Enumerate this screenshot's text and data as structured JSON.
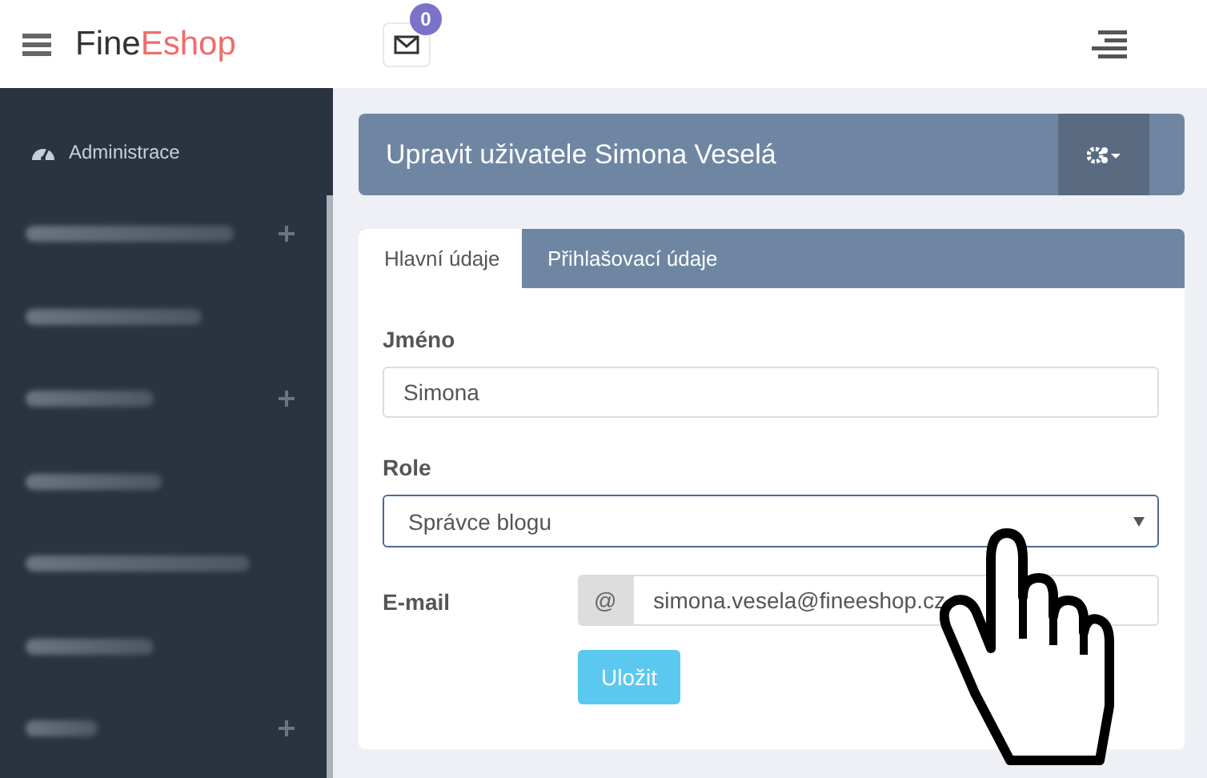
{
  "topbar": {
    "brand_first": "Fine",
    "brand_second": "Eshop",
    "messages_badge": "0"
  },
  "sidebar": {
    "items": [
      {
        "kind": "link",
        "label": "Administrace"
      },
      {
        "kind": "blurred",
        "expandable": true
      },
      {
        "kind": "blurred",
        "expandable": false
      },
      {
        "kind": "blurred",
        "expandable": true
      },
      {
        "kind": "blurred",
        "expandable": false
      },
      {
        "kind": "blurred",
        "expandable": false
      },
      {
        "kind": "blurred",
        "expandable": false
      },
      {
        "kind": "blurred",
        "expandable": true
      }
    ]
  },
  "header": {
    "title": "Upravit uživatele Simona Veselá"
  },
  "tabs": [
    {
      "label": "Hlavní údaje",
      "selected": true
    },
    {
      "label": "Přihlašovací údaje",
      "selected": false
    }
  ],
  "form": {
    "name_label": "Jméno",
    "name_value": "Simona",
    "role_label": "Role",
    "role_value": "Správce blogu",
    "email_label": "E-mail",
    "email_addon": "@",
    "email_value": "simona.vesela@fineeshop.cz",
    "save_button": "Uložit"
  }
}
